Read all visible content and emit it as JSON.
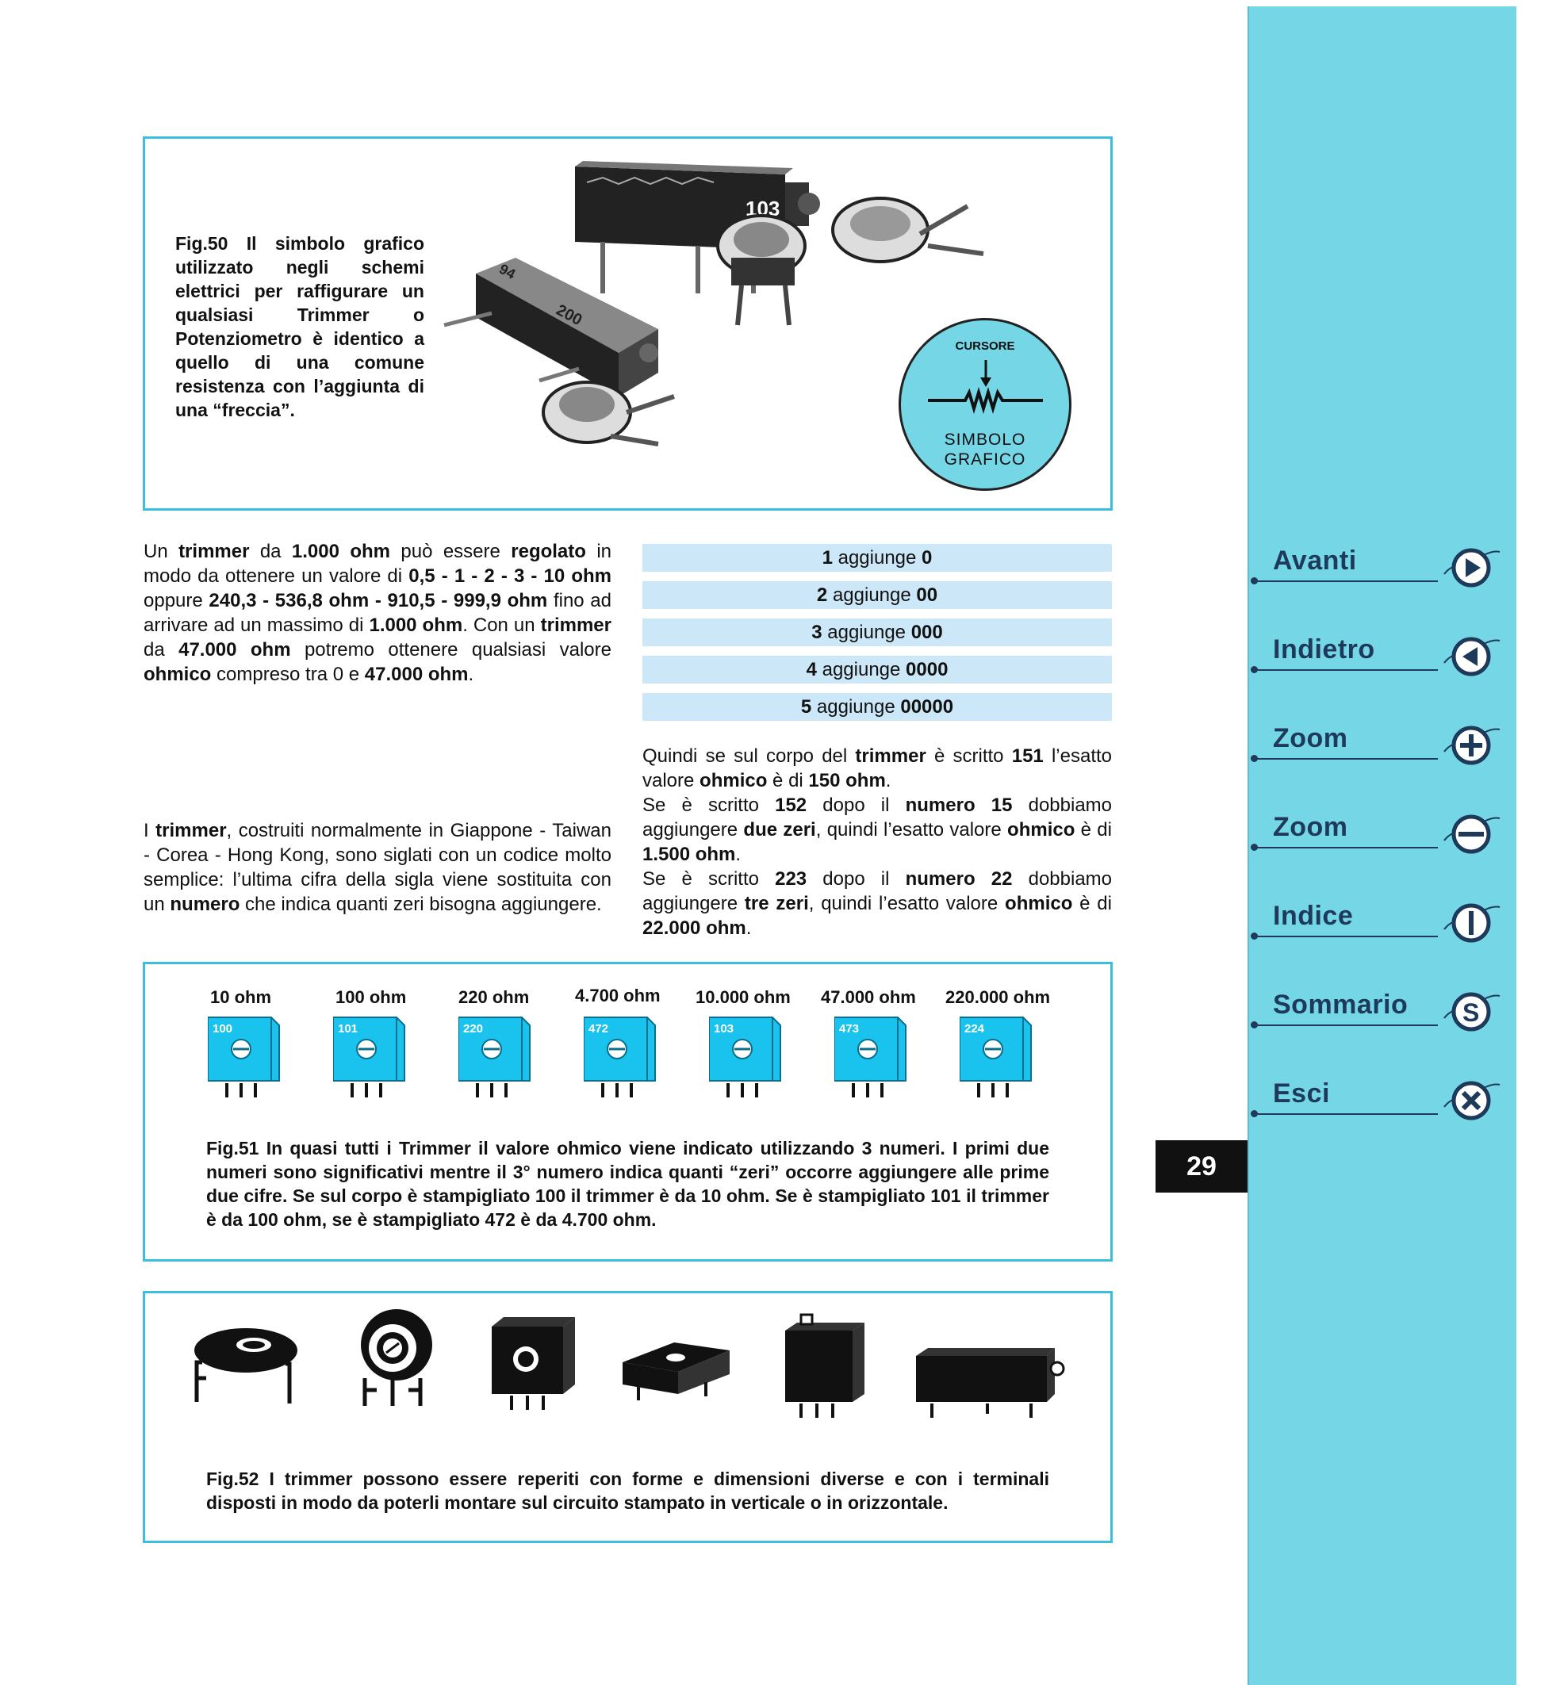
{
  "fig50": {
    "caption": "Fig.50 Il simbolo grafico utilizzato negli schemi elettrici per raffigurare un qualsiasi Trimmer o Potenziometro è identico a quello di una comune resistenza con l’aggiunta di una “freccia”.",
    "photo_marking_1": "103",
    "photo_marking_2": "200",
    "photo_marking_3": "94",
    "cursor_label": "CURSORE",
    "symbol_label_1": "SIMBOLO",
    "symbol_label_2": "GRAFICO"
  },
  "left_text": {
    "p1": "Un trimmer da 1.000 ohm può essere regolato in modo da ottenere un valore di 0,5 - 1 - 2 - 3 - 10 ohm oppure 240,3 - 536,8 ohm - 910,5 - 999,9 ohm fino ad arrivare ad un massimo di 1.000 ohm. Con un trimmer da 47.000 ohm potremo ottenere qualsiasi valore ohmico compreso tra 0 e 47.000 ohm.",
    "p2": "I trimmer, costruiti normalmente in Giappone - Taiwan - Corea - Hong Kong, sono siglati con un codice molto semplice: l’ultima cifra della sigla viene sostituita con un numero che indica quanti zeri bisogna aggiungere."
  },
  "zeros_table": [
    {
      "digit": "1",
      "word": "aggiunge",
      "zeros": "0"
    },
    {
      "digit": "2",
      "word": "aggiunge",
      "zeros": "00"
    },
    {
      "digit": "3",
      "word": "aggiunge",
      "zeros": "000"
    },
    {
      "digit": "4",
      "word": "aggiunge",
      "zeros": "0000"
    },
    {
      "digit": "5",
      "word": "aggiunge",
      "zeros": "00000"
    }
  ],
  "right_text": {
    "p1": "Quindi se sul corpo del trimmer è scritto 151 l’esatto valore ohmico è di 150 ohm.",
    "p2": "Se è scritto 152 dopo il numero 15 dobbiamo aggiungere due zeri, quindi l’esatto valore ohmico è di 1.500 ohm.",
    "p3": "Se è scritto 223 dopo il numero 22 dobbiamo aggiungere tre zeri, quindi l’esatto valore ohmico è di 22.000 ohm."
  },
  "fig51": {
    "trimmers": [
      {
        "value": "10 ohm",
        "code": "100"
      },
      {
        "value": "100 ohm",
        "code": "101"
      },
      {
        "value": "220 ohm",
        "code": "220"
      },
      {
        "value": "4.700 ohm",
        "code": "472"
      },
      {
        "value": "10.000 ohm",
        "code": "103"
      },
      {
        "value": "47.000 ohm",
        "code": "473"
      },
      {
        "value": "220.000 ohm",
        "code": "224"
      }
    ],
    "caption": "Fig.51 In quasi tutti i Trimmer il valore ohmico viene indicato utilizzando 3 numeri. I primi due numeri sono significativi mentre il 3° numero indica quanti “zeri” occorre aggiungere alle prime due cifre. Se sul corpo è stampigliato 100 il trimmer è da 10 ohm. Se è stampigliato 101 il trimmer è da 100 ohm, se è stampigliato 472 è da 4.700 ohm."
  },
  "fig52": {
    "caption": "Fig.52 I trimmer possono essere reperiti con forme e dimensioni diverse e con i terminali disposti in modo da poterli montare sul circuito stampato in verticale o in orizzontale."
  },
  "nav": {
    "items": [
      {
        "label": "Avanti",
        "icon": "play-right-icon"
      },
      {
        "label": "Indietro",
        "icon": "play-left-icon"
      },
      {
        "label": "Zoom",
        "icon": "plus-icon"
      },
      {
        "label": "Zoom",
        "icon": "minus-icon"
      },
      {
        "label": "Indice",
        "icon": "info-i-icon"
      },
      {
        "label": "Sommario",
        "icon": "s-letter-icon"
      },
      {
        "label": "Esci",
        "icon": "close-x-icon"
      }
    ]
  },
  "page_number": "29",
  "colors": {
    "sidebar": "#75d6e6",
    "frame": "#3bbfe0",
    "table_row": "#cbe7f8",
    "trimmer_body": "#19c3ee",
    "nav_text": "#1e3a5a"
  }
}
